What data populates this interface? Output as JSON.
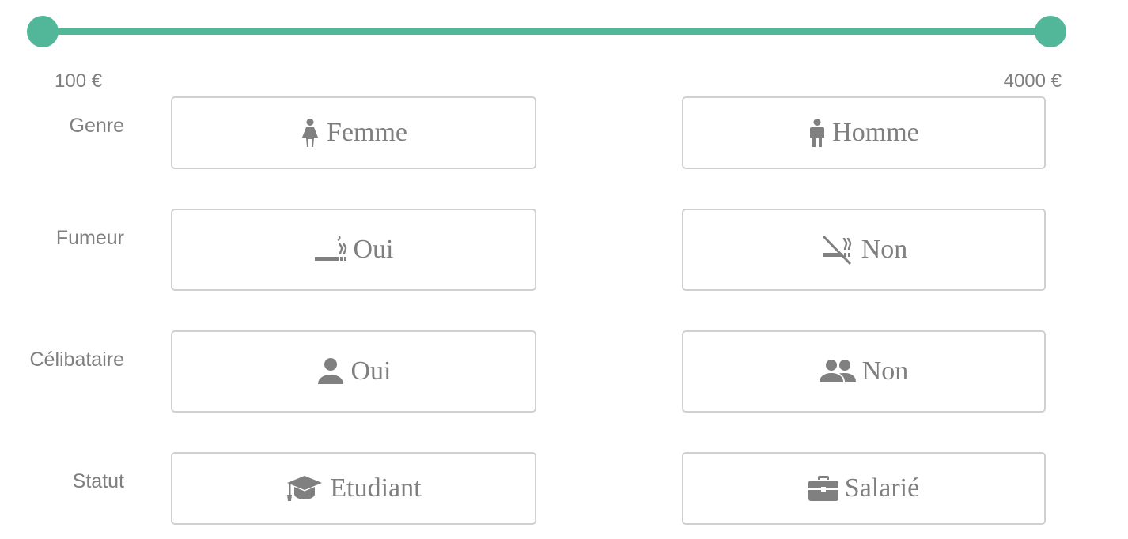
{
  "slider": {
    "accent_color": "#52b799",
    "min_label": "100 €",
    "max_label": "4000 €",
    "value_low_fraction": 0,
    "value_high_fraction": 1
  },
  "rows": [
    {
      "label": "Genre",
      "options": [
        {
          "label": "Femme",
          "icon": "female-icon"
        },
        {
          "label": "Homme",
          "icon": "male-icon"
        }
      ]
    },
    {
      "label": "Fumeur",
      "options": [
        {
          "label": "Oui",
          "icon": "smoking-icon"
        },
        {
          "label": "Non",
          "icon": "no-smoking-icon"
        }
      ]
    },
    {
      "label": "Célibataire",
      "options": [
        {
          "label": "Oui",
          "icon": "person-icon"
        },
        {
          "label": "Non",
          "icon": "people-icon"
        }
      ]
    },
    {
      "label": "Statut",
      "options": [
        {
          "label": "Etudiant",
          "icon": "graduation-cap-icon"
        },
        {
          "label": "Salarié",
          "icon": "briefcase-icon"
        }
      ]
    }
  ]
}
